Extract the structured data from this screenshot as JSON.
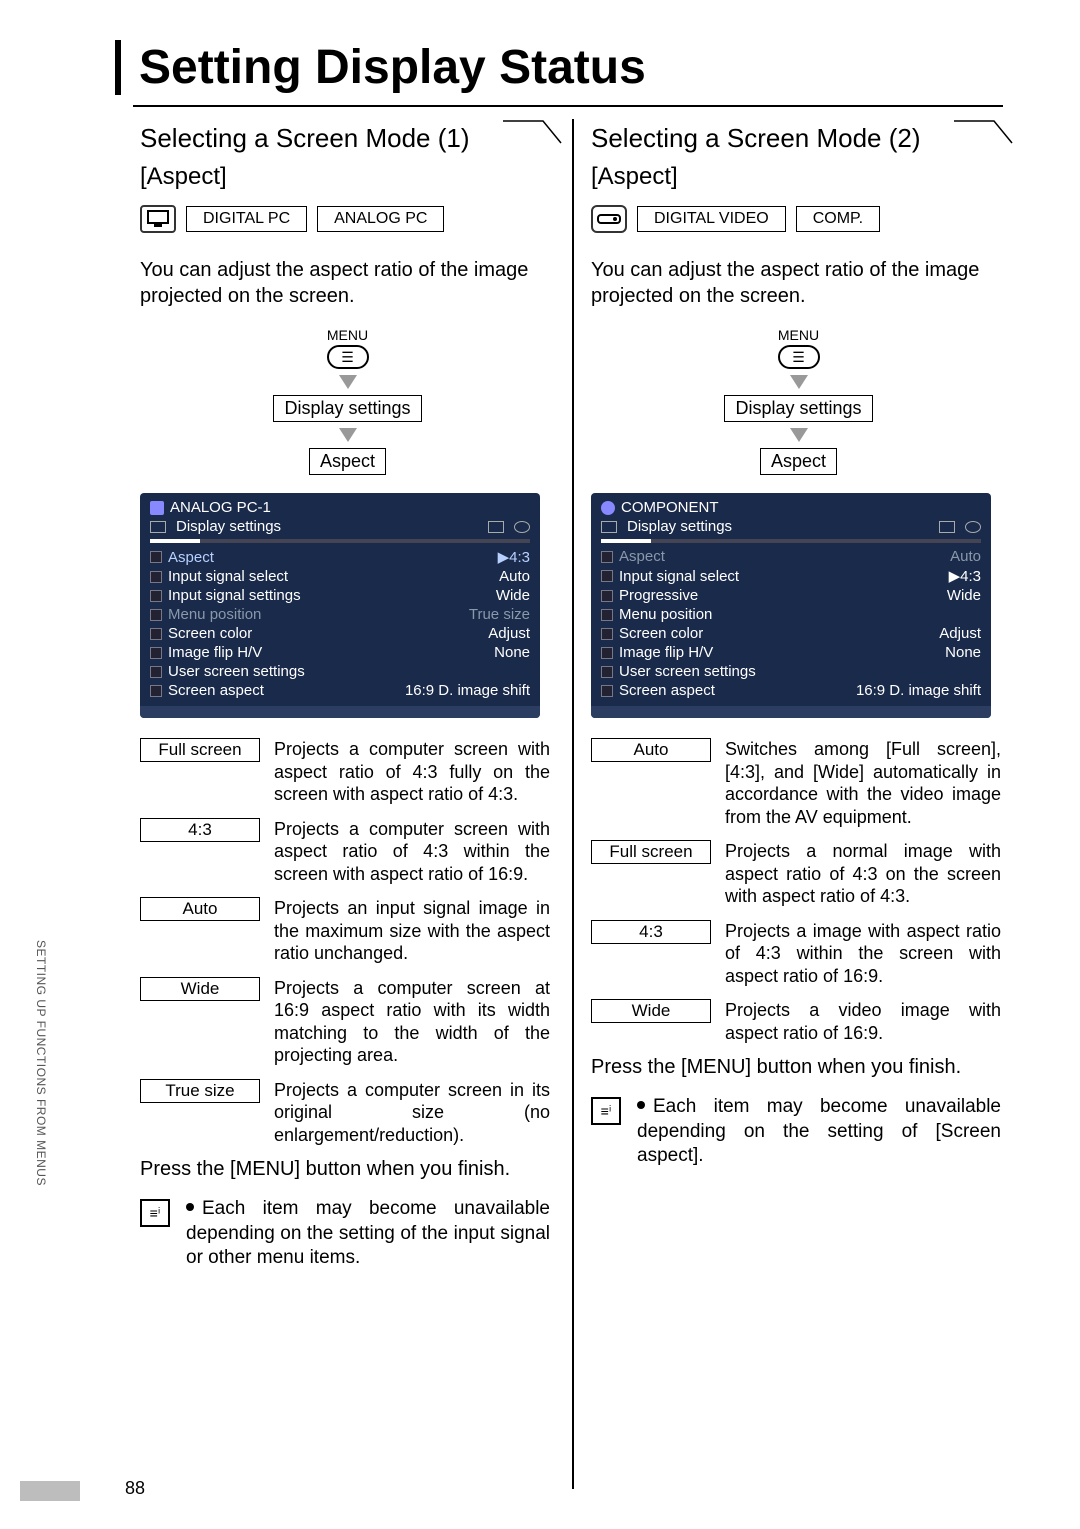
{
  "title": "Setting Display Status",
  "sideTab": "SETTING UP FUNCTIONS FROM MENUS",
  "pageNum": "88",
  "menuWord": "MENU",
  "pathStep1": "Display settings",
  "pathStep2": "Aspect",
  "finishText": "Press the [MENU] button when you finish.",
  "left": {
    "heading": "Selecting a Screen Mode (1)",
    "sub": "[Aspect]",
    "chips": [
      "DIGITAL PC",
      "ANALOG PC"
    ],
    "intro": "You can adjust the aspect ratio of the image projected on the screen.",
    "osdTitle": "ANALOG PC-1",
    "osdTab": "Display settings",
    "osdRows": [
      {
        "l": "Aspect",
        "r": "▶4:3",
        "hl": true
      },
      {
        "l": "Input signal select",
        "r": "Auto"
      },
      {
        "l": "Input signal settings",
        "r": "Wide"
      },
      {
        "l": "Menu position",
        "r": "True size",
        "dim": true
      },
      {
        "l": "Screen color",
        "r": "Adjust"
      },
      {
        "l": "Image flip H/V",
        "r": "None"
      },
      {
        "l": "User screen settings",
        "r": ""
      },
      {
        "l": "Screen aspect",
        "r": "16:9 D. image shift"
      }
    ],
    "options": [
      {
        "label": "Full screen",
        "desc": "Projects a computer screen with aspect ratio of 4:3 fully on the screen with aspect ratio of 4:3."
      },
      {
        "label": "4:3",
        "desc": "Projects a computer screen with aspect ratio of 4:3 within the screen with aspect ratio of 16:9."
      },
      {
        "label": "Auto",
        "desc": "Projects an input signal image in the maximum size with the aspect ratio unchanged."
      },
      {
        "label": "Wide",
        "desc": "Projects a computer screen at 16:9 aspect ratio with its width matching to the width of the projecting area."
      },
      {
        "label": "True size",
        "desc": "Projects a computer screen in its original size (no enlargement/reduction)."
      }
    ],
    "note": "Each item may become unavailable depending on the setting of the input signal or other menu items."
  },
  "right": {
    "heading": "Selecting a Screen Mode (2)",
    "sub": "[Aspect]",
    "chips": [
      "DIGITAL VIDEO",
      "COMP."
    ],
    "intro": "You can adjust the aspect ratio of the image projected on the screen.",
    "osdTitle": "COMPONENT",
    "osdTab": "Display settings",
    "osdRows": [
      {
        "l": "Aspect",
        "r": "Auto",
        "dim": true,
        "hl": true
      },
      {
        "l": "Input signal select",
        "r": "▶4:3"
      },
      {
        "l": "Progressive",
        "r": "Wide"
      },
      {
        "l": "Menu position",
        "r": ""
      },
      {
        "l": "Screen color",
        "r": "Adjust"
      },
      {
        "l": "Image flip H/V",
        "r": "None"
      },
      {
        "l": "User screen settings",
        "r": ""
      },
      {
        "l": "Screen aspect",
        "r": "16:9 D. image shift"
      }
    ],
    "options": [
      {
        "label": "Auto",
        "desc": "Switches among [Full screen], [4:3], and [Wide] automatically in accordance with the video image from the AV equipment."
      },
      {
        "label": "Full screen",
        "desc": "Projects a normal image with aspect ratio of 4:3 on the screen with aspect ratio of 4:3."
      },
      {
        "label": "4:3",
        "desc": "Projects a image with aspect ratio of 4:3 within the screen with aspect ratio of 16:9."
      },
      {
        "label": "Wide",
        "desc": "Projects a video image with aspect ratio of 16:9."
      }
    ],
    "note": "Each item may become unavailable depending on the setting of [Screen aspect]."
  }
}
